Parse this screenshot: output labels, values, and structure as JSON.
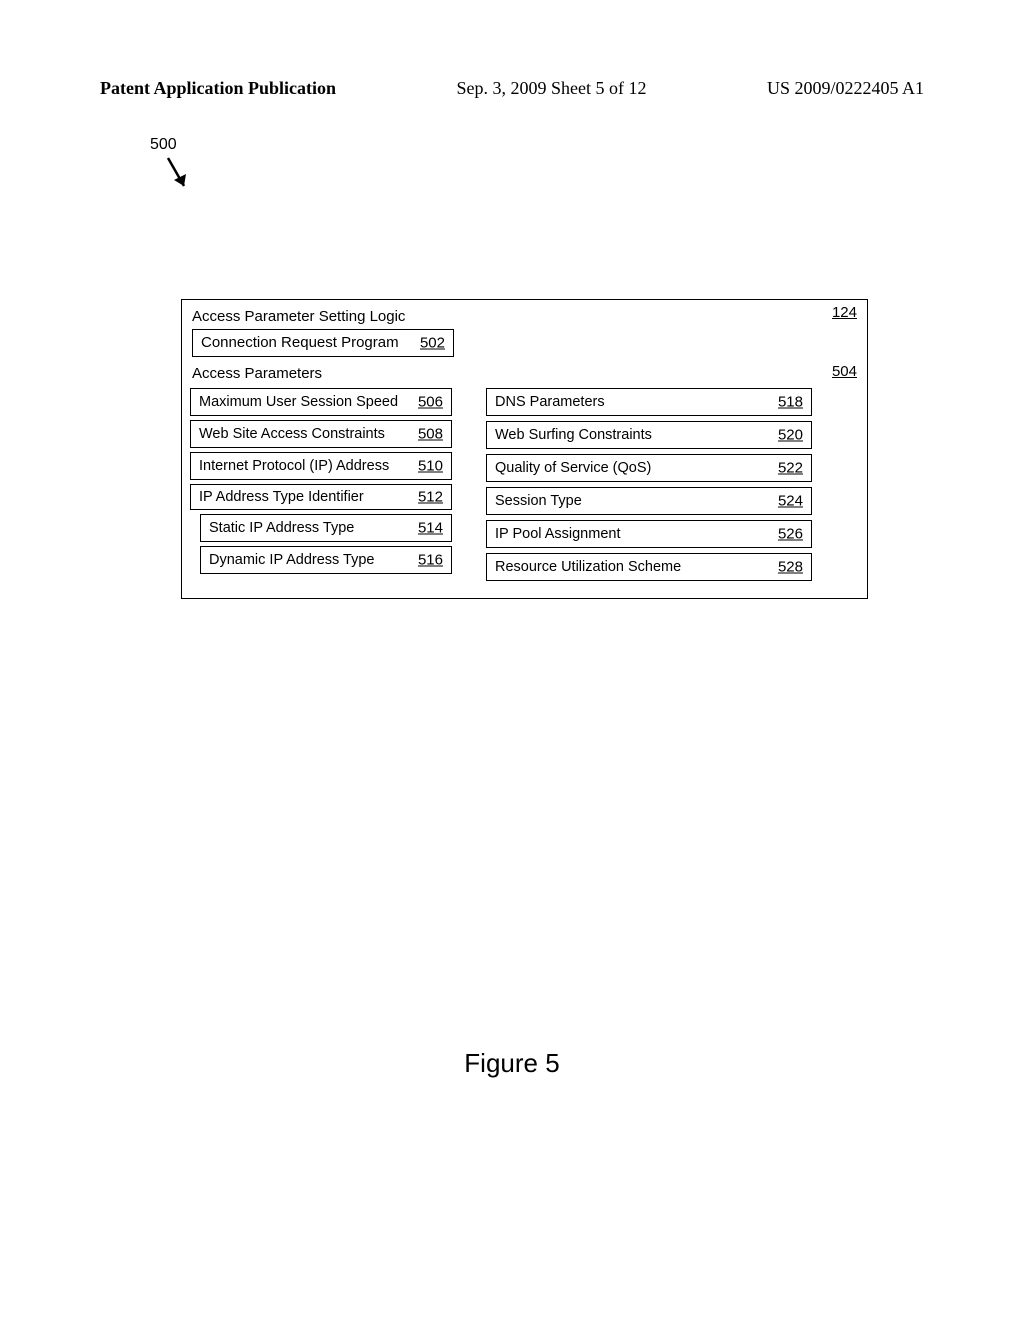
{
  "header": {
    "left": "Patent Application Publication",
    "center": "Sep. 3, 2009  Sheet 5 of 12",
    "right": "US 2009/0222405 A1"
  },
  "callout": {
    "number": "500"
  },
  "outer": {
    "title": "Access Parameter Setting Logic",
    "ref": "124"
  },
  "crp": {
    "label": "Connection Request Program",
    "ref": "502"
  },
  "params": {
    "title": "Access Parameters",
    "ref": "504"
  },
  "left_items": {
    "r0": {
      "label": "Maximum User Session Speed",
      "ref": "506"
    },
    "r1": {
      "label": "Web Site Access Constraints",
      "ref": "508"
    },
    "r2": {
      "label": "Internet Protocol (IP) Address",
      "ref": "510"
    },
    "r3": {
      "label": "IP Address Type Identifier",
      "ref": "512"
    },
    "r4": {
      "label": "Static IP Address Type",
      "ref": "514"
    },
    "r5": {
      "label": "Dynamic IP Address Type",
      "ref": "516"
    }
  },
  "right_items": {
    "r0": {
      "label": "DNS Parameters",
      "ref": "518"
    },
    "r1": {
      "label": "Web Surfing Constraints",
      "ref": "520"
    },
    "r2": {
      "label": "Quality of Service (QoS)",
      "ref": "522"
    },
    "r3": {
      "label": "Session Type",
      "ref": "524"
    },
    "r4": {
      "label": "IP Pool Assignment",
      "ref": "526"
    },
    "r5": {
      "label": "Resource Utilization Scheme",
      "ref": "528"
    }
  },
  "figure": {
    "caption": "Figure 5"
  }
}
